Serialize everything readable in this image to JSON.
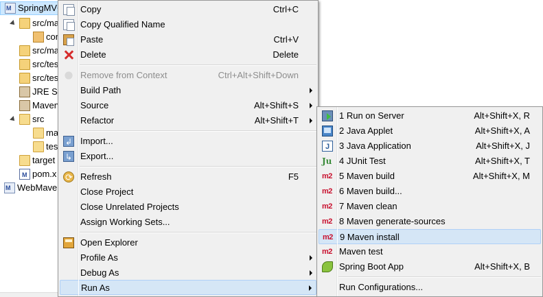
{
  "tree": {
    "items": [
      {
        "label": "SpringMVC",
        "icon": "maven-project-icon"
      },
      {
        "label": "src/ma",
        "icon": "source-folder-icon"
      },
      {
        "label": "cor",
        "icon": "package-icon"
      },
      {
        "label": "src/ma",
        "icon": "source-folder-icon"
      },
      {
        "label": "src/tes",
        "icon": "source-folder-icon"
      },
      {
        "label": "src/tes",
        "icon": "source-folder-icon"
      },
      {
        "label": "JRE Sy",
        "icon": "library-icon"
      },
      {
        "label": "Maven",
        "icon": "library-icon"
      },
      {
        "label": "src",
        "icon": "folder-icon"
      },
      {
        "label": "ma",
        "icon": "folder-icon"
      },
      {
        "label": "tes",
        "icon": "folder-icon"
      },
      {
        "label": "target",
        "icon": "folder-icon"
      },
      {
        "label": "pom.x",
        "icon": "pom-file-icon"
      },
      {
        "label": "WebMave",
        "icon": "maven-project-icon"
      }
    ]
  },
  "context_menu": {
    "items": [
      {
        "label": "Copy",
        "shortcut": "Ctrl+C",
        "icon": "copy-icon"
      },
      {
        "label": "Copy Qualified Name",
        "shortcut": "",
        "icon": "copy-icon"
      },
      {
        "label": "Paste",
        "shortcut": "Ctrl+V",
        "icon": "paste-icon"
      },
      {
        "label": "Delete",
        "shortcut": "Delete",
        "icon": "delete-icon"
      },
      {
        "label": "Remove from Context",
        "shortcut": "Ctrl+Alt+Shift+Down",
        "icon": "remove-context-icon",
        "disabled": true
      },
      {
        "label": "Build Path",
        "shortcut": "",
        "submenu": true
      },
      {
        "label": "Source",
        "shortcut": "Alt+Shift+S",
        "submenu": true
      },
      {
        "label": "Refactor",
        "shortcut": "Alt+Shift+T",
        "submenu": true
      },
      {
        "label": "Import...",
        "shortcut": "",
        "icon": "import-icon"
      },
      {
        "label": "Export...",
        "shortcut": "",
        "icon": "export-icon"
      },
      {
        "label": "Refresh",
        "shortcut": "F5",
        "icon": "refresh-icon"
      },
      {
        "label": "Close Project",
        "shortcut": ""
      },
      {
        "label": "Close Unrelated Projects",
        "shortcut": ""
      },
      {
        "label": "Assign Working Sets...",
        "shortcut": ""
      },
      {
        "label": "Open Explorer",
        "shortcut": "",
        "icon": "explorer-icon"
      },
      {
        "label": "Profile As",
        "shortcut": "",
        "submenu": true
      },
      {
        "label": "Debug As",
        "shortcut": "",
        "submenu": true
      },
      {
        "label": "Run As",
        "shortcut": "",
        "submenu": true,
        "highlighted": true
      }
    ]
  },
  "run_as_menu": {
    "items": [
      {
        "label": "1 Run on Server",
        "shortcut": "Alt+Shift+X, R",
        "icon": "server-icon"
      },
      {
        "label": "2 Java Applet",
        "shortcut": "Alt+Shift+X, A",
        "icon": "java-applet-icon"
      },
      {
        "label": "3 Java Application",
        "shortcut": "Alt+Shift+X, J",
        "icon": "java-application-icon"
      },
      {
        "label": "4 JUnit Test",
        "shortcut": "Alt+Shift+X, T",
        "icon": "junit-icon",
        "glyph": "Ju"
      },
      {
        "label": "5 Maven build",
        "shortcut": "Alt+Shift+X, M",
        "icon": "maven-m2-icon",
        "glyph": "m2"
      },
      {
        "label": "6 Maven build...",
        "shortcut": "",
        "icon": "maven-m2-icon",
        "glyph": "m2"
      },
      {
        "label": "7 Maven clean",
        "shortcut": "",
        "icon": "maven-m2-icon",
        "glyph": "m2"
      },
      {
        "label": "8 Maven generate-sources",
        "shortcut": "",
        "icon": "maven-m2-icon",
        "glyph": "m2"
      },
      {
        "label": "9 Maven install",
        "shortcut": "",
        "icon": "maven-m2-icon",
        "glyph": "m2",
        "highlighted": true
      },
      {
        "label": "Maven test",
        "shortcut": "",
        "icon": "maven-m2-icon",
        "glyph": "m2"
      },
      {
        "label": "Spring Boot App",
        "shortcut": "Alt+Shift+X, B",
        "icon": "spring-boot-icon"
      },
      {
        "label": "Run Configurations...",
        "shortcut": ""
      }
    ]
  },
  "colors": {
    "menu_bg": "#f0f0f0",
    "highlight_bg": "#d5e6f6",
    "highlight_border": "#aecff7",
    "disabled_text": "#8d8d8d",
    "m2_red": "#c8102e"
  }
}
